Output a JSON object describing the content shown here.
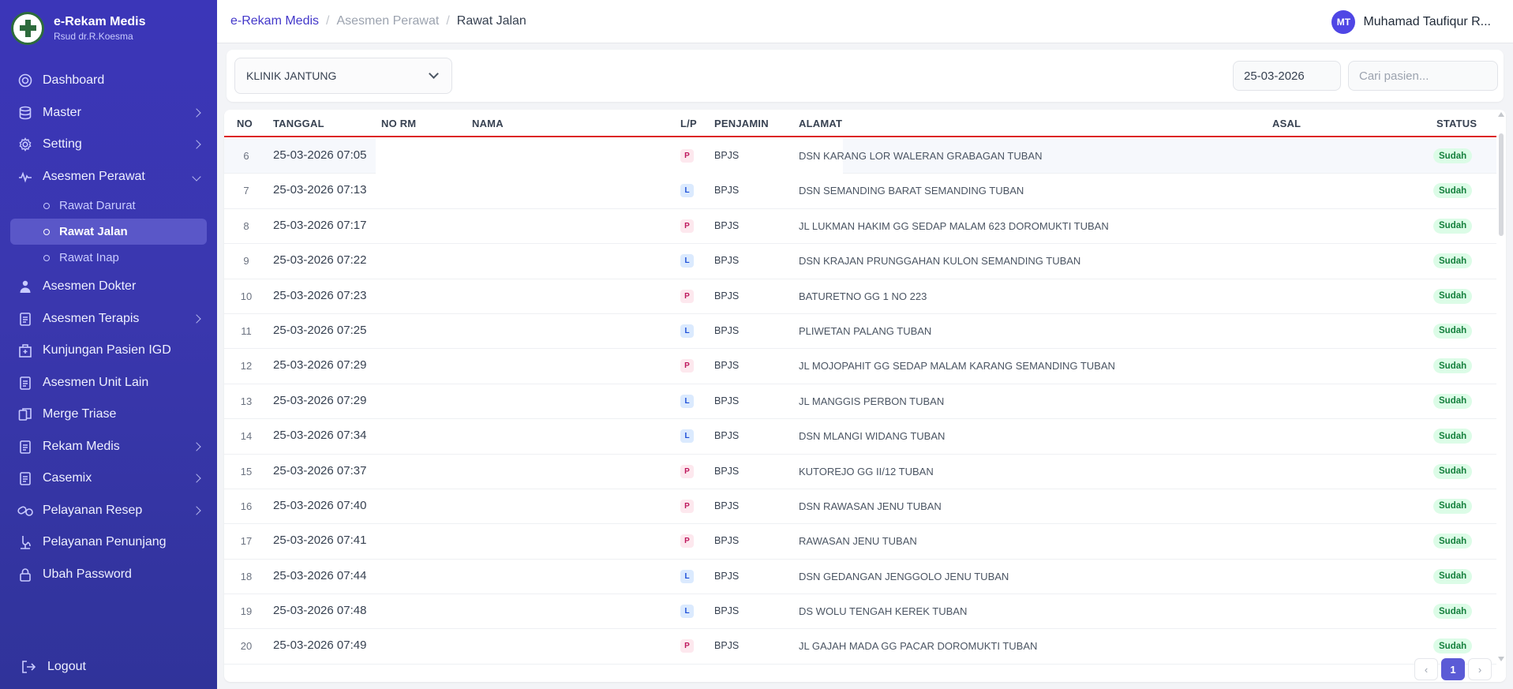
{
  "app": {
    "title": "e-Rekam Medis",
    "subtitle": "Rsud dr.R.Koesma"
  },
  "sidebar": {
    "items": [
      {
        "label": "Dashboard",
        "icon": "dashboard-icon",
        "chevron": false
      },
      {
        "label": "Master",
        "icon": "database-icon",
        "chevron": true
      },
      {
        "label": "Setting",
        "icon": "gear-icon",
        "chevron": true
      },
      {
        "label": "Asesmen Perawat",
        "icon": "pulse-icon",
        "chevron": true,
        "expanded": true
      },
      {
        "label": "Asesmen Dokter",
        "icon": "doctor-icon",
        "chevron": false
      },
      {
        "label": "Asesmen Terapis",
        "icon": "clipboard-icon",
        "chevron": true
      },
      {
        "label": "Kunjungan Pasien IGD",
        "icon": "hospital-icon",
        "chevron": false
      },
      {
        "label": "Asesmen Unit Lain",
        "icon": "clipboard-icon",
        "chevron": false
      },
      {
        "label": "Merge Triase",
        "icon": "merge-icon",
        "chevron": false
      },
      {
        "label": "Rekam Medis",
        "icon": "clipboard-icon",
        "chevron": true
      },
      {
        "label": "Casemix",
        "icon": "clipboard-icon",
        "chevron": true
      },
      {
        "label": "Pelayanan Resep",
        "icon": "pill-icon",
        "chevron": true
      },
      {
        "label": "Pelayanan Penunjang",
        "icon": "microscope-icon",
        "chevron": false
      },
      {
        "label": "Ubah Password",
        "icon": "lock-icon",
        "chevron": false
      }
    ],
    "subitems": [
      {
        "label": "Rawat Darurat",
        "active": false
      },
      {
        "label": "Rawat Jalan",
        "active": true
      },
      {
        "label": "Rawat Inap",
        "active": false
      }
    ],
    "logout": "Logout"
  },
  "header": {
    "breadcrumb": [
      "e-Rekam Medis",
      "Asesmen Perawat",
      "Rawat Jalan"
    ],
    "user": {
      "initials": "MT",
      "name": "Muhamad Taufiqur R..."
    }
  },
  "filters": {
    "clinic": "KLINIK JANTUNG",
    "date": "25-03-2026",
    "search_placeholder": "Cari pasien..."
  },
  "table": {
    "columns": [
      "NO",
      "TANGGAL",
      "NO RM",
      "NAMA",
      "L/P",
      "PENJAMIN",
      "ALAMAT",
      "ASAL",
      "STATUS"
    ],
    "rows": [
      {
        "no": "6",
        "tanggal": "25-03-2026 07:05",
        "lp": "P",
        "penjamin": "BPJS",
        "alamat": "DSN KARANG LOR WALERAN GRABAGAN TUBAN",
        "status": "Sudah"
      },
      {
        "no": "7",
        "tanggal": "25-03-2026 07:13",
        "lp": "L",
        "penjamin": "BPJS",
        "alamat": "DSN SEMANDING BARAT SEMANDING TUBAN",
        "status": "Sudah"
      },
      {
        "no": "8",
        "tanggal": "25-03-2026 07:17",
        "lp": "P",
        "penjamin": "BPJS",
        "alamat": "JL LUKMAN HAKIM GG SEDAP MALAM 623 DOROMUKTI TUBAN",
        "status": "Sudah"
      },
      {
        "no": "9",
        "tanggal": "25-03-2026 07:22",
        "lp": "L",
        "penjamin": "BPJS",
        "alamat": "DSN KRAJAN PRUNGGAHAN KULON SEMANDING TUBAN",
        "status": "Sudah"
      },
      {
        "no": "10",
        "tanggal": "25-03-2026 07:23",
        "lp": "P",
        "penjamin": "BPJS",
        "alamat": "BATURETNO GG 1 NO 223",
        "status": "Sudah"
      },
      {
        "no": "11",
        "tanggal": "25-03-2026 07:25",
        "lp": "L",
        "penjamin": "BPJS",
        "alamat": "PLIWETAN PALANG TUBAN",
        "status": "Sudah"
      },
      {
        "no": "12",
        "tanggal": "25-03-2026 07:29",
        "lp": "P",
        "penjamin": "BPJS",
        "alamat": "JL MOJOPAHIT GG SEDAP MALAM KARANG SEMANDING TUBAN",
        "status": "Sudah"
      },
      {
        "no": "13",
        "tanggal": "25-03-2026 07:29",
        "lp": "L",
        "penjamin": "BPJS",
        "alamat": "JL MANGGIS PERBON TUBAN",
        "status": "Sudah"
      },
      {
        "no": "14",
        "tanggal": "25-03-2026 07:34",
        "lp": "L",
        "penjamin": "BPJS",
        "alamat": "DSN MLANGI WIDANG TUBAN",
        "status": "Sudah"
      },
      {
        "no": "15",
        "tanggal": "25-03-2026 07:37",
        "lp": "P",
        "penjamin": "BPJS",
        "alamat": "KUTOREJO GG II/12 TUBAN",
        "status": "Sudah"
      },
      {
        "no": "16",
        "tanggal": "25-03-2026 07:40",
        "lp": "P",
        "penjamin": "BPJS",
        "alamat": "DSN RAWASAN JENU TUBAN",
        "status": "Sudah"
      },
      {
        "no": "17",
        "tanggal": "25-03-2026 07:41",
        "lp": "P",
        "penjamin": "BPJS",
        "alamat": "RAWASAN JENU TUBAN",
        "status": "Sudah"
      },
      {
        "no": "18",
        "tanggal": "25-03-2026 07:44",
        "lp": "L",
        "penjamin": "BPJS",
        "alamat": "DSN GEDANGAN JENGGOLO JENU TUBAN",
        "status": "Sudah"
      },
      {
        "no": "19",
        "tanggal": "25-03-2026 07:48",
        "lp": "L",
        "penjamin": "BPJS",
        "alamat": "DS WOLU TENGAH KEREK TUBAN",
        "status": "Sudah"
      },
      {
        "no": "20",
        "tanggal": "25-03-2026 07:49",
        "lp": "P",
        "penjamin": "BPJS",
        "alamat": "JL GAJAH MADA GG PACAR DOROMUKTI TUBAN",
        "status": "Sudah"
      }
    ]
  },
  "pagination": {
    "current": "1"
  },
  "colors": {
    "sidebar": "#3b36b8",
    "accent": "#4f46e5",
    "header_rule": "#dc2626",
    "status_bg": "#dcfce7",
    "status_text": "#15803d"
  }
}
